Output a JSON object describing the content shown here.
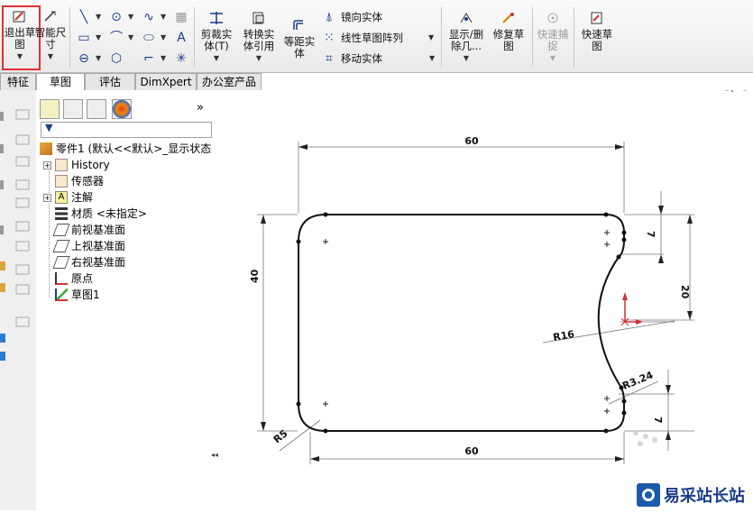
{
  "ribbon": {
    "exit_sketch": "退出草\n图",
    "smart_dim": "智能尺\n寸",
    "trim": "剪裁实\n体(T)",
    "convert": "转换实\n体引用",
    "offset": "等距实\n体",
    "mirror": "镜向实体",
    "linear_pattern": "线性草图阵列",
    "move": "移动实体",
    "show_delete": "显示/删\n除几...",
    "repair": "修复草\n图",
    "quick_snap": "快速捕\n捉",
    "rapid_sketch": "快速草\n图"
  },
  "tabs": [
    "特征",
    "草图",
    "评估",
    "DimXpert",
    "办公室产品"
  ],
  "tree": {
    "root": "零件1  (默认<<默认>_显示状态",
    "items": [
      "History",
      "传感器",
      "注解",
      "材质 <未指定>",
      "前视基准面",
      "上视基准面",
      "右视基准面",
      "原点",
      "草图1"
    ]
  },
  "drawing": {
    "dims": {
      "top_width": "60",
      "bottom_width": "60",
      "height": "40",
      "right_top": "7",
      "right_mid": "20",
      "right_bottom": "7",
      "r16": "R16",
      "r3": "R3.24",
      "r5": "R5"
    }
  },
  "watermark": "易采站长站",
  "colors": {
    "highlight": "#e03030",
    "accent": "#1a3c8a"
  }
}
